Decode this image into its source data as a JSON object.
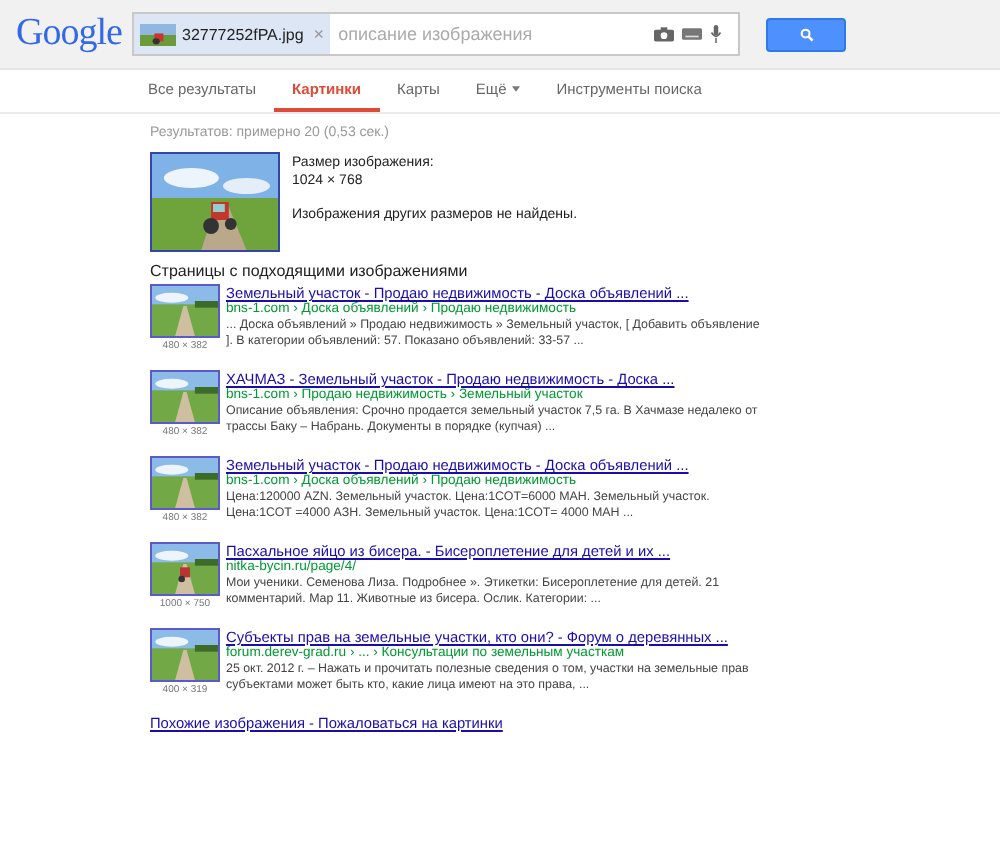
{
  "header": {
    "logo": "Google",
    "file_chip": {
      "name": "32777252fPA.jpg",
      "close": "×"
    },
    "search": {
      "placeholder": "описание изображения"
    }
  },
  "tabs": [
    {
      "label": "Все результаты",
      "selected": false,
      "kind": "plain"
    },
    {
      "label": "Картинки",
      "selected": true,
      "kind": "plain"
    },
    {
      "label": "Карты",
      "selected": false,
      "kind": "plain"
    },
    {
      "label": "Ещё",
      "selected": false,
      "kind": "dropdown"
    },
    {
      "label": "Инструменты поиска",
      "selected": false,
      "kind": "plain"
    }
  ],
  "result_stats": "Результатов: примерно 20 (0,53 сек.)",
  "image_info": {
    "kind": "picture",
    "size_label": "Размер изображения:",
    "size": "1024 × 768",
    "note": "Изображения других размеров не найдены."
  },
  "section_title": "Страницы с подходящими изображениями",
  "results": [
    {
      "title": "Земельный участок - Продаю недвижимость - Доска объявлений ...",
      "url": "bns-1.com › Доска объявлений › Продаю недвижимость",
      "snippet": "... Доска объявлений » Продаю недвижимость » Земельный участок, [ Добавить объявление ]. В категории объявлений: 57. Показано объявлений: 33-57 ...",
      "dims": "480 × 382",
      "kind": "road"
    },
    {
      "title": "ХАЧМАЗ - Земельный участок - Продаю недвижимость - Доска ...",
      "url": "bns-1.com › Продаю недвижимость › Земельный участок",
      "snippet": "Описание объявления: Срочно продается земельный участок 7,5 га. В Хачмазе недалеко от трассы Баку – Набрань. Документы в порядке (купчая) ...",
      "dims": "480 × 382",
      "kind": "road"
    },
    {
      "title": "Земельный участок - Продаю недвижимость - Доска объявлений ...",
      "url": "bns-1.com › Доска объявлений › Продаю недвижимость",
      "snippet": "Цена:120000 AZN. Земельный участок. Цена:1СОТ=6000 МАН. Земельный участок. Цена:1СОТ =4000 АЗН. Земельный участок. Цена:1СОТ= 4000 МАН ...",
      "dims": "480 × 382",
      "kind": "road"
    },
    {
      "title": "Пасхальное яйцо из бисера. - Бисероплетение для детей и их ...",
      "url": "nitka-bycin.ru/page/4/",
      "snippet": "Мои ученики. Семенова Лиза. Подробнее ». Этикетки: Бисероплетение для детей. 21 комментарий. Мар 11. Животные из бисера. Ослик. Категории: ...",
      "dims": "1000 × 750",
      "kind": "tractor"
    },
    {
      "title": "Субъекты прав на земельные участки, кто они? - Форум о деревянных ...",
      "url": "forum.derev-grad.ru › ... › Консультации по земельным участкам",
      "snippet": "25 окт. 2012 г. – Нажать и прочитать полезные сведения о том, участки на земельные прав субъектами может быть кто, какие лица имеют на это права, ...",
      "dims": "400 × 319",
      "kind": "road"
    }
  ],
  "footer_link": "Похожие изображения - Пожаловаться на картинки"
}
